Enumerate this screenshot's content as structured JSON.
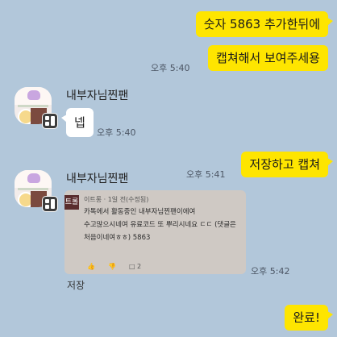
{
  "messages": {
    "m1": {
      "text": "숫자 5863 추가한뒤에"
    },
    "m2": {
      "text": "캡쳐해서 보여주세용",
      "time": "오후 5:40"
    },
    "m3": {
      "sender": "내부자님찐팬",
      "text": "넵",
      "time": "오후 5:40"
    },
    "m4": {
      "text": "저장하고 캡쳐",
      "time": "오후 5:41"
    },
    "m5": {
      "sender": "내부자님찐팬",
      "time": "오후 5:42",
      "caption": "저장",
      "image": {
        "logo": "트롤",
        "meta": "이트롱 · 1일 전(수정됨)",
        "lines": [
          "카톡에서 활동중인 내부자님찐팬이에여",
          "수고많으시네여 유료코드 또 뿌리시네요 ㄷㄷ (댓글은",
          "처음이네여ㅎㅎ) 5863"
        ],
        "like_count": "",
        "reply_count": "2"
      }
    },
    "m6": {
      "text": "완료!"
    }
  },
  "icons": {
    "like": "thumbs-up-icon",
    "dislike": "thumbs-down-icon",
    "reply": "comment-icon"
  },
  "colors": {
    "background": "#b2c7da",
    "my_bubble": "#fee500",
    "other_bubble": "#ffffff"
  }
}
